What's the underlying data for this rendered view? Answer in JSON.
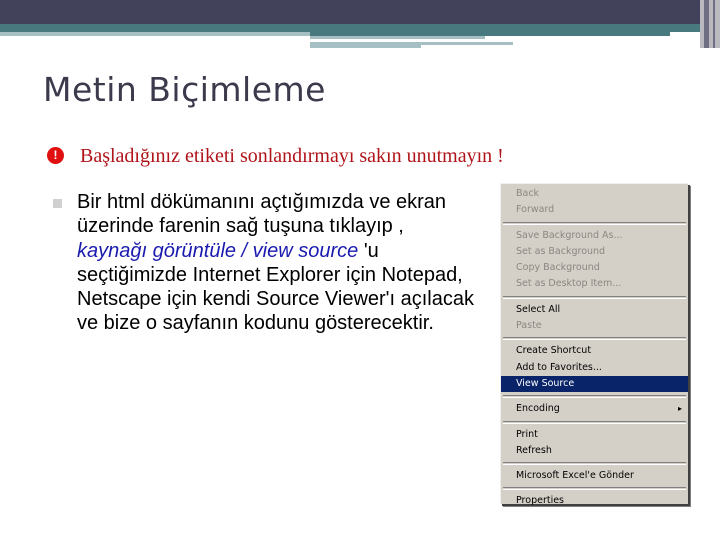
{
  "slide": {
    "title": "Metin Biçimleme",
    "warning": {
      "icon": "exclamation-circle-icon",
      "text": "Başladığınız etiketi sonlandırmayı sakın unutmayın !"
    },
    "bullet": {
      "icon": "square-bullet-icon",
      "part1": "Bir html dökümanını açtığımızda ve ekran üzerinde farenin sağ tuşuna tıklayıp ,",
      "emphasis": "kaynağı görüntüle / view source",
      "part2": " 'u seçtiğimizde Internet Explorer için Notepad, Netscape için kendi Source Viewer'ı açılacak ve bize o sayfanın kodunu gösterecektir."
    }
  },
  "context_menu": {
    "groups": [
      [
        {
          "label": "Back",
          "disabled": true
        },
        {
          "label": "Forward",
          "disabled": true
        }
      ],
      [
        {
          "label": "Save Background As...",
          "disabled": true
        },
        {
          "label": "Set as Background",
          "disabled": true
        },
        {
          "label": "Copy Background",
          "disabled": true
        },
        {
          "label": "Set as Desktop Item...",
          "disabled": true
        }
      ],
      [
        {
          "label": "Select All",
          "disabled": false
        },
        {
          "label": "Paste",
          "disabled": true
        }
      ],
      [
        {
          "label": "Create Shortcut",
          "disabled": false
        },
        {
          "label": "Add to Favorites...",
          "disabled": false
        },
        {
          "label": "View Source",
          "disabled": false,
          "selected": true
        }
      ],
      [
        {
          "label": "Encoding",
          "disabled": false,
          "submenu": true
        }
      ],
      [
        {
          "label": "Print",
          "disabled": false
        },
        {
          "label": "Refresh",
          "disabled": false
        }
      ],
      [
        {
          "label": "Microsoft Excel'e Gönder",
          "disabled": false
        }
      ],
      [
        {
          "label": "Properties",
          "disabled": false
        }
      ]
    ],
    "submenu_icon": "▸"
  },
  "colors": {
    "header_dark": "#42435a",
    "header_teal": "#48797f",
    "warning_red": "#b0141a",
    "link_blue": "#1a1ab0",
    "menu_bg": "#d4d0c8",
    "menu_selected": "#0a246a"
  }
}
